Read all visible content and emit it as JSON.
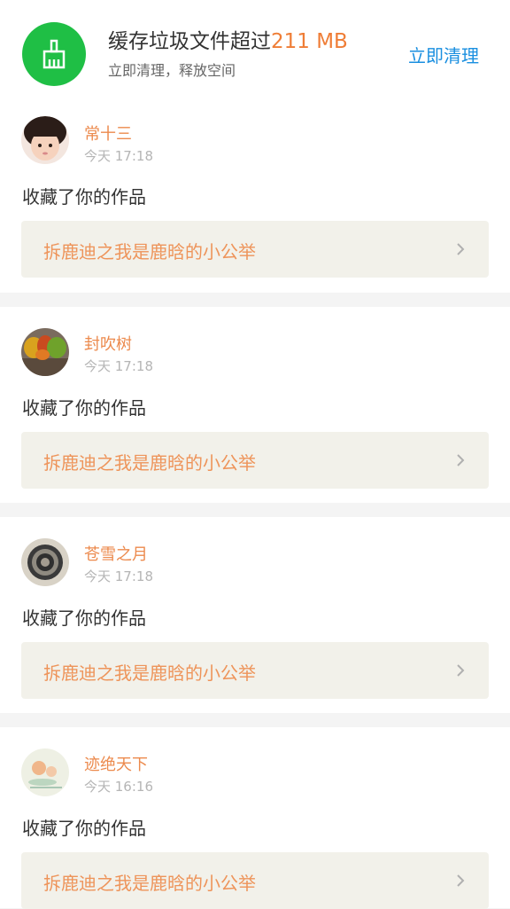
{
  "banner": {
    "title_prefix": "缓存垃圾文件超过",
    "size": "211 MB",
    "subtitle": "立即清理，释放空间",
    "action": "立即清理",
    "icon": "broom-icon",
    "icon_bg": "#1fbf45",
    "action_color": "#1a8fe0",
    "size_color": "#ef7d36"
  },
  "feed": [
    {
      "name": "常十三",
      "time": "今天 17:18",
      "action": "收藏了你的作品",
      "work": "拆鹿迪之我是鹿晗的小公举"
    },
    {
      "name": "封吹树",
      "time": "今天 17:18",
      "action": "收藏了你的作品",
      "work": "拆鹿迪之我是鹿晗的小公举"
    },
    {
      "name": "苍雪之月",
      "time": "今天 17:18",
      "action": "收藏了你的作品",
      "work": "拆鹿迪之我是鹿晗的小公举"
    },
    {
      "name": "迹绝天下",
      "time": "今天 16:16",
      "action": "收藏了你的作品",
      "work": "拆鹿迪之我是鹿晗的小公举"
    }
  ]
}
